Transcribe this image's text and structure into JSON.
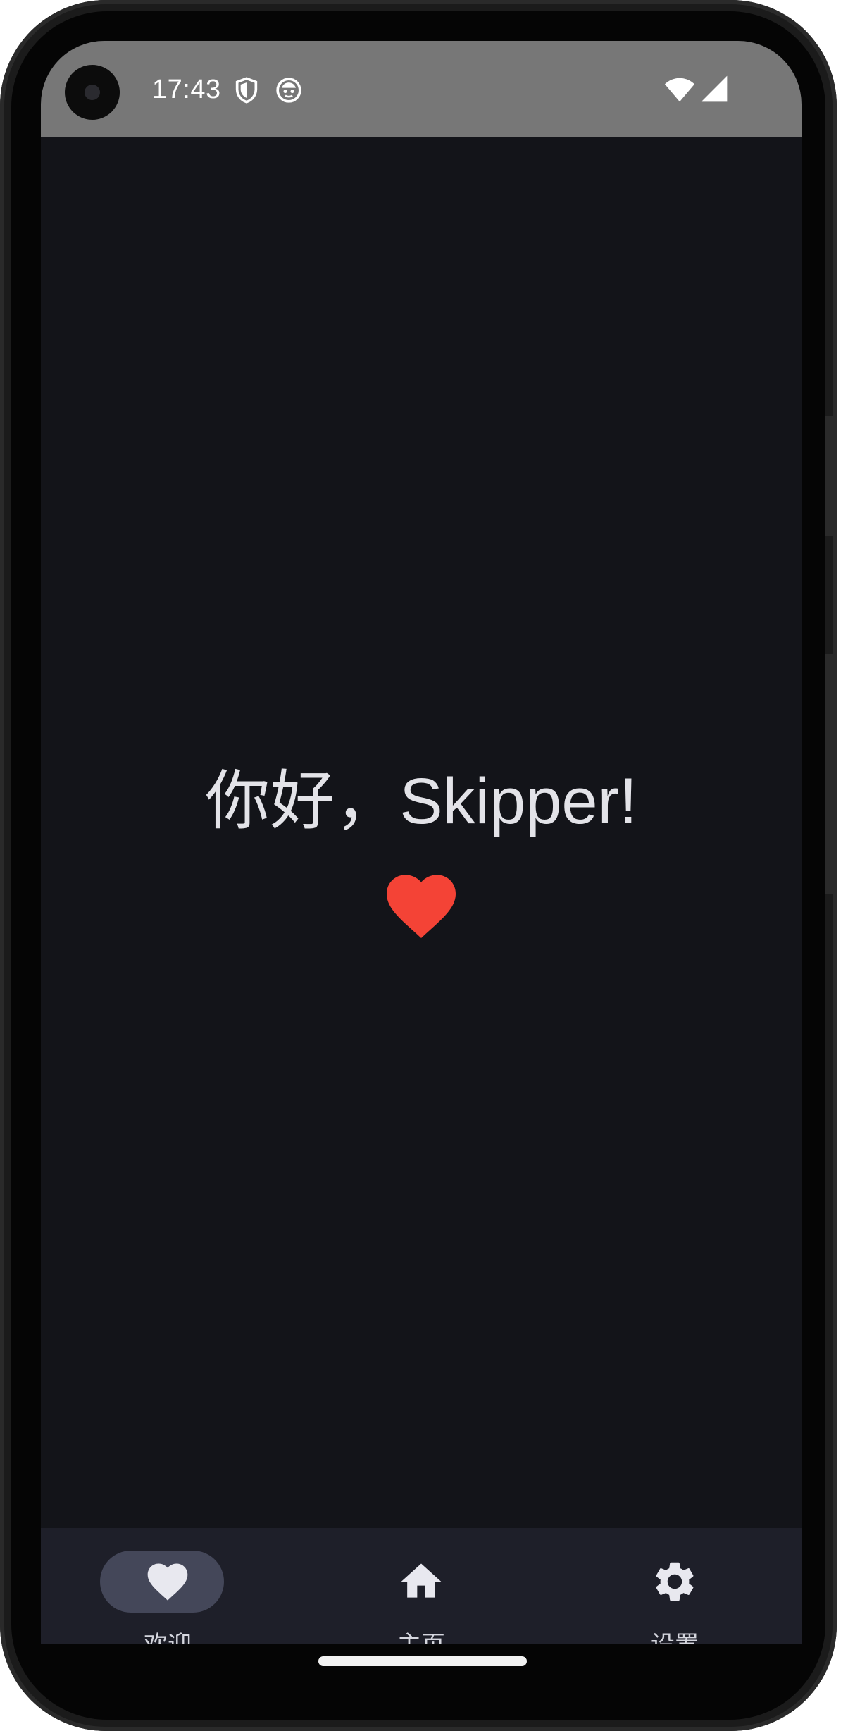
{
  "status_bar": {
    "time": "17:43",
    "icons": [
      "shield-icon",
      "app-notification-icon",
      "wifi-icon",
      "cell-signal-icon"
    ]
  },
  "main": {
    "greeting": "你好，Skipper!",
    "icon": "heart-icon",
    "icon_color": "#f44336"
  },
  "bottom_nav": {
    "items": [
      {
        "label": "欢迎",
        "icon": "heart-icon",
        "selected": true
      },
      {
        "label": "主页",
        "icon": "home-icon",
        "selected": false
      },
      {
        "label": "设置",
        "icon": "gear-icon",
        "selected": false
      }
    ]
  },
  "colors": {
    "background": "#131419",
    "status_bar": "#777777",
    "nav_bar": "#1e1f29",
    "selected_pill": "#444759",
    "text": "#e3e3e8"
  }
}
